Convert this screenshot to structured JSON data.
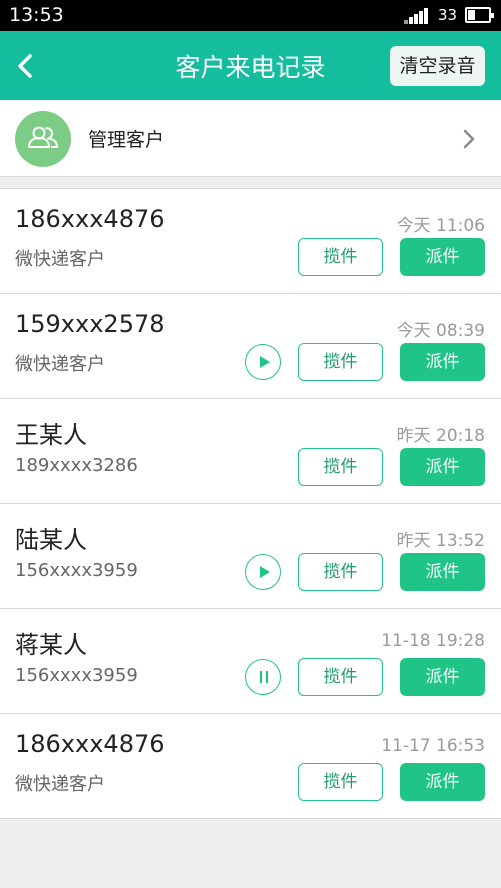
{
  "status_bar": {
    "time": "13:53",
    "battery": "33",
    "battery_level": 0.33
  },
  "header": {
    "title": "客户来电记录",
    "clear_label": "清空录音"
  },
  "manage": {
    "label": "管理客户"
  },
  "calls": [
    {
      "name": "186xxx4876",
      "sub": "微快递客户",
      "time": "今天 11:06",
      "audio": "none"
    },
    {
      "name": "159xxx2578",
      "sub": "微快递客户",
      "time": "今天 08:39",
      "audio": "play"
    },
    {
      "name": "王某人",
      "sub": "189xxxx3286",
      "time": "昨天 20:18",
      "audio": "none"
    },
    {
      "name": "陆某人",
      "sub": "156xxxx3959",
      "time": "昨天 13:52",
      "audio": "play"
    },
    {
      "name": "蒋某人",
      "sub": "156xxxx3959",
      "time": "11-18 19:28",
      "audio": "pause"
    },
    {
      "name": "186xxx4876",
      "sub": "微快递客户",
      "time": "11-17 16:53",
      "audio": "none"
    }
  ],
  "actions": {
    "pickup_label": "揽件",
    "dispatch_label": "派件"
  },
  "colors": {
    "header": "#13bd9d",
    "accent": "#1fc486",
    "avatar": "#7dcc86"
  }
}
